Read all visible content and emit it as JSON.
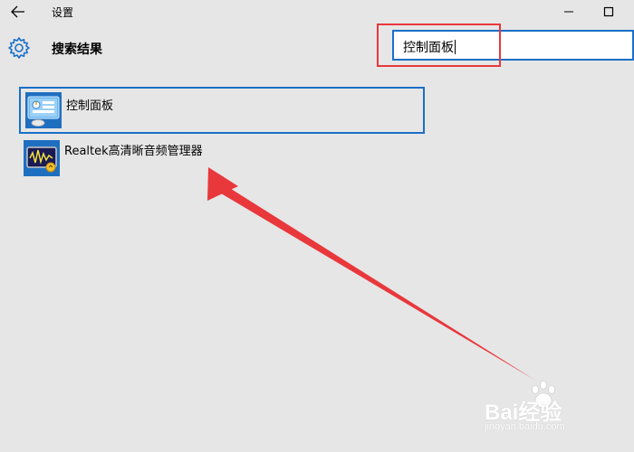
{
  "window": {
    "title": "设置",
    "back_icon": "back-arrow-icon",
    "minimize_icon": "minimize-icon",
    "maximize_icon": "maximize-icon"
  },
  "header": {
    "icon": "gear-icon",
    "title": "搜索结果"
  },
  "search": {
    "value": "控制面板"
  },
  "results": [
    {
      "label": "控制面板",
      "icon": "control-panel-icon",
      "selected": true
    },
    {
      "label": "Realtek高清晰音频管理器",
      "icon": "realtek-audio-icon",
      "selected": false
    }
  ],
  "annotation": {
    "highlight_color": "#e8383c",
    "arrow_color": "#e8383c"
  },
  "watermark": {
    "brand": "Bai经验",
    "url": "jingyan.baidu.com"
  },
  "colors": {
    "accent": "#1a6fc9",
    "background": "#e6e6e6"
  }
}
